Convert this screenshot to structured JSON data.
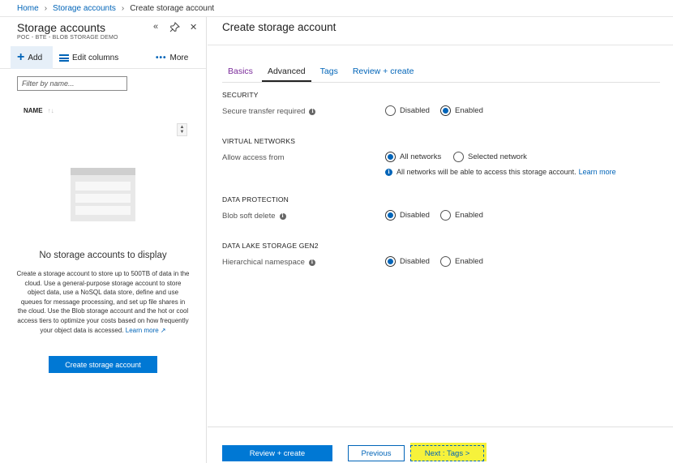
{
  "breadcrumb": {
    "home": "Home",
    "storage_accounts": "Storage accounts",
    "current": "Create storage account"
  },
  "left_panel": {
    "title": "Storage accounts",
    "subtitle": "POC - BTE - BLOB STORAGE DEMO",
    "controls": {
      "collapse": "«",
      "pin": "📌",
      "close": "✕"
    },
    "toolbar": {
      "add": "Add",
      "edit_columns": "Edit columns",
      "more": "More"
    },
    "filter_placeholder": "Filter by name...",
    "column_name": "NAME",
    "empty_title": "No storage accounts to display",
    "empty_desc": "Create a storage account to store up to 500TB of data in the cloud. Use a general-purpose storage account to store object data, use a NoSQL data store, define and use queues for message processing, and set up file shares in the cloud. Use the Blob storage account and the hot or cool access tiers to optimize your costs based on how frequently your object data is accessed.",
    "learn_more": "Learn more",
    "create_button": "Create storage account"
  },
  "main": {
    "title": "Create storage account",
    "tabs": [
      {
        "label": "Basics"
      },
      {
        "label": "Advanced",
        "active": true
      },
      {
        "label": "Tags"
      },
      {
        "label": "Review + create"
      }
    ],
    "sections": {
      "security": {
        "heading": "SECURITY",
        "label": "Secure transfer required",
        "options": [
          "Disabled",
          "Enabled"
        ],
        "selected": "Enabled"
      },
      "virtual_networks": {
        "heading": "VIRTUAL NETWORKS",
        "label": "Allow access from",
        "options": [
          "All networks",
          "Selected network"
        ],
        "selected": "All networks",
        "note": "All networks will be able to access this storage account.",
        "note_link": "Learn more"
      },
      "data_protection": {
        "heading": "DATA PROTECTION",
        "label": "Blob soft delete",
        "options": [
          "Disabled",
          "Enabled"
        ],
        "selected": "Disabled"
      },
      "data_lake": {
        "heading": "DATA LAKE STORAGE GEN2",
        "label": "Hierarchical namespace",
        "options": [
          "Disabled",
          "Enabled"
        ],
        "selected": "Disabled"
      }
    },
    "footer": {
      "review_create": "Review + create",
      "previous": "Previous",
      "next": "Next : Tags >"
    },
    "colors": {
      "accent": "#0078d4",
      "link": "#0064b8",
      "highlight": "#f6f23b"
    }
  }
}
